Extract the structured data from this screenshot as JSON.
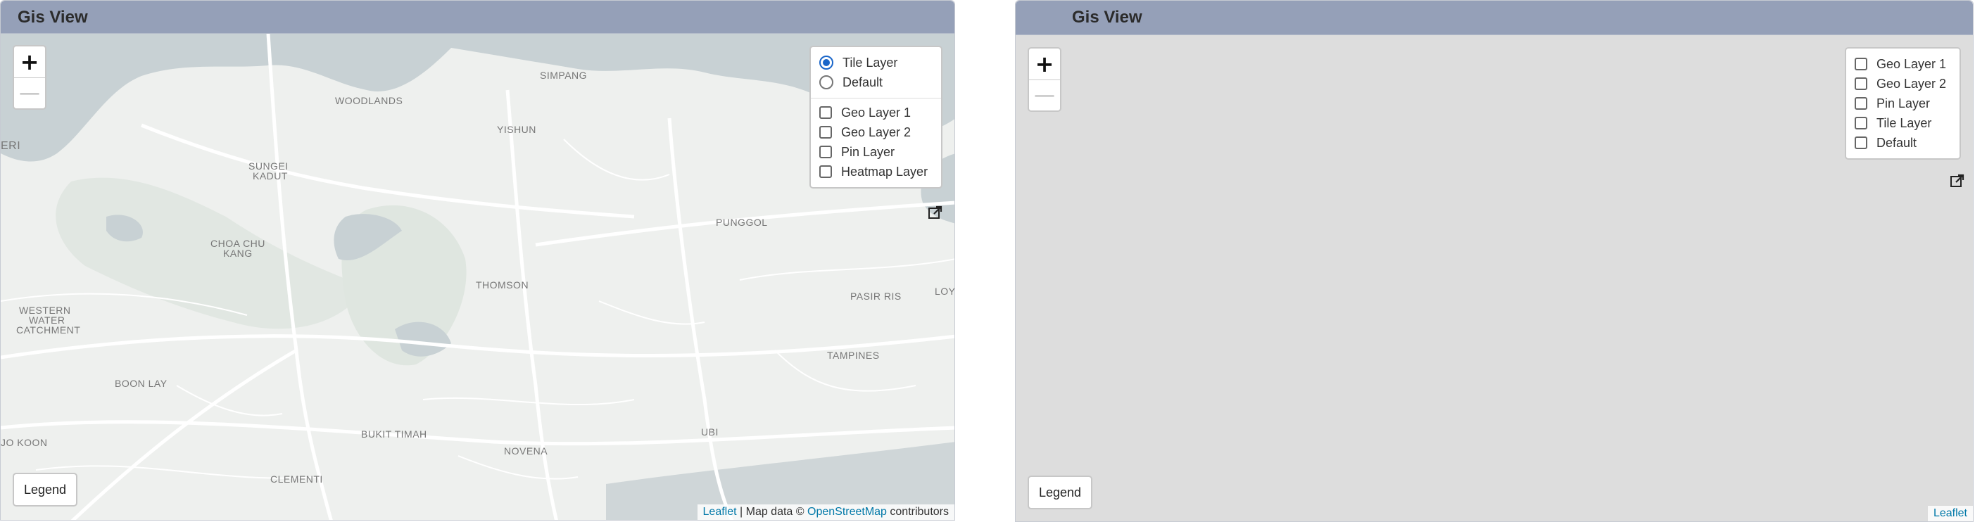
{
  "panels": [
    {
      "title": "Gis View",
      "zoom": {
        "in": "+",
        "out": "—"
      },
      "base_layers": [
        {
          "label": "Tile Layer",
          "selected": true
        },
        {
          "label": "Default",
          "selected": false
        }
      ],
      "overlays": [
        {
          "label": "Geo Layer 1",
          "checked": false
        },
        {
          "label": "Geo Layer 2",
          "checked": false
        },
        {
          "label": "Pin Layer",
          "checked": false
        },
        {
          "label": "Heatmap Layer",
          "checked": false
        }
      ],
      "legend_label": "Legend",
      "attribution": {
        "leaflet": "Leaflet",
        "separator": " | Map data © ",
        "osm": "OpenStreetMap",
        "suffix": " contributors"
      },
      "map_labels": {
        "woodlands": "WOODLANDS",
        "simpang": "SIMPANG",
        "yishun": "YISHUN",
        "sungei_kadut_1": "SUNGEI",
        "sungei_kadut_2": "KADUT",
        "choa_chu_kang_1": "CHOA CHU",
        "choa_chu_kang_2": "KANG",
        "punggol": "PUNGGOL",
        "thomson": "THOMSON",
        "pasir_ris": "PASIR RIS",
        "loy": "LOY",
        "western_1": "WESTERN",
        "western_2": "WATER",
        "western_3": "CATCHMENT",
        "boon_lay": "BOON LAY",
        "tampines": "TAMPINES",
        "bukit_timah": "BUKIT TIMAH",
        "novena": "NOVENA",
        "ubi": "UBI",
        "clementi": "CLEMENTI",
        "jo_koon": "JO KOON",
        "eri": "ERI"
      },
      "colors": {
        "header": "#95a0b8",
        "map_water": "#c7d0d3",
        "map_land": "#eef0ee"
      }
    },
    {
      "title": "Gis View",
      "zoom": {
        "in": "+",
        "out": "—"
      },
      "overlays": [
        {
          "label": "Geo Layer 1",
          "checked": false
        },
        {
          "label": "Geo Layer 2",
          "checked": false
        },
        {
          "label": "Pin Layer",
          "checked": false
        },
        {
          "label": "Tile Layer",
          "checked": false
        },
        {
          "label": "Default",
          "checked": false
        }
      ],
      "legend_label": "Legend",
      "attribution": {
        "leaflet": "Leaflet"
      },
      "colors": {
        "header": "#95a0b8",
        "map_background": "#dddddd"
      }
    }
  ]
}
